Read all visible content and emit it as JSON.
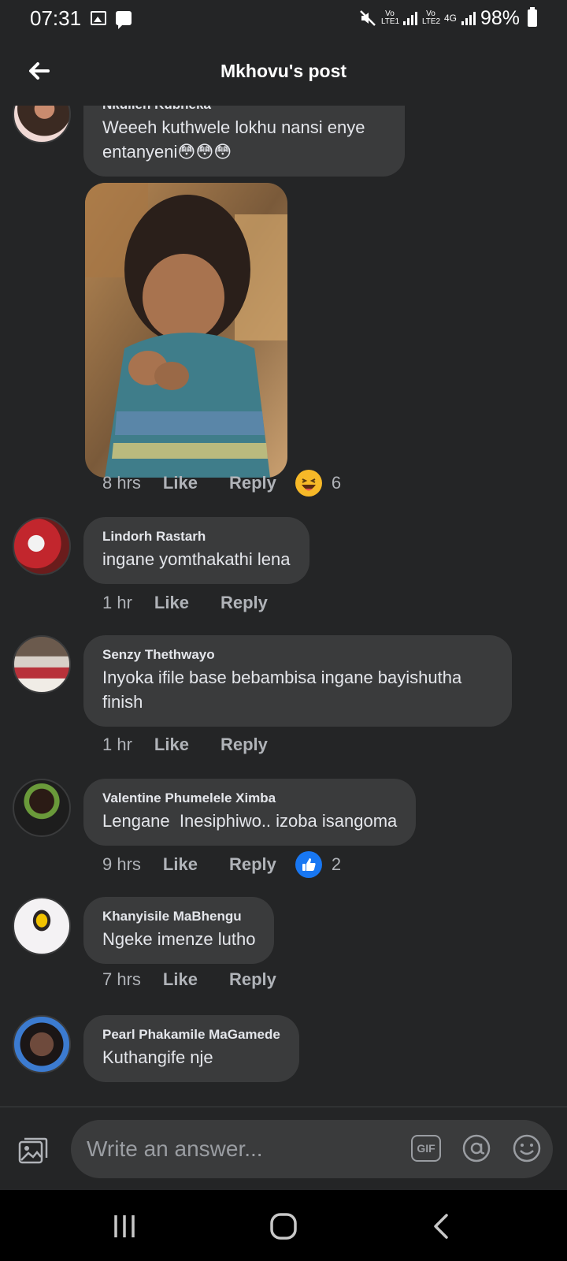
{
  "status_bar": {
    "time": "07:31",
    "battery": "98%",
    "sim1": "Vo LTE1",
    "sim2": "Vo LTE2",
    "network": "4G"
  },
  "header": {
    "title": "Mkhovu's post",
    "back_icon": "arrow-left-icon"
  },
  "comments": [
    {
      "author": "Nkulleh Kubheka",
      "text": "Weeeh kuthwele lokhu nansi enye entanyeni😳😳😳",
      "time": "8 hrs",
      "like": "Like",
      "reply": "Reply",
      "reaction_icon": "haha-emoji-icon",
      "reaction_count": "6",
      "has_photo": true
    },
    {
      "author": "Lindorh Rastarh",
      "text": "ingane yomthakathi lena",
      "time": "1 hr",
      "like": "Like",
      "reply": "Reply"
    },
    {
      "author": "Senzy Thethwayo",
      "text": "Inyoka ifile base bebambisa ingane bayishutha finish",
      "time": "1 hr",
      "like": "Like",
      "reply": "Reply"
    },
    {
      "author": "Valentine Phumelele Ximba",
      "text": "Lengane  Inesiphiwo.. izoba isangoma",
      "time": "9 hrs",
      "like": "Like",
      "reply": "Reply",
      "reaction_icon": "thumbs-up-icon",
      "reaction_count": "2"
    },
    {
      "author": "Khanyisile MaBhengu",
      "text": "Ngeke imenze lutho",
      "time": "7 hrs",
      "like": "Like",
      "reply": "Reply"
    },
    {
      "author": "Pearl Phakamile MaGamede",
      "text": "Kuthangife nje"
    }
  ],
  "composer": {
    "placeholder": "Write an answer...",
    "gif_label": "GIF"
  },
  "colors": {
    "background": "#242526",
    "bubble": "#3a3b3c",
    "text": "#e4e6eb",
    "muted": "#b0b3b8",
    "like_blue": "#1877f2",
    "haha_yellow": "#f7b928"
  }
}
